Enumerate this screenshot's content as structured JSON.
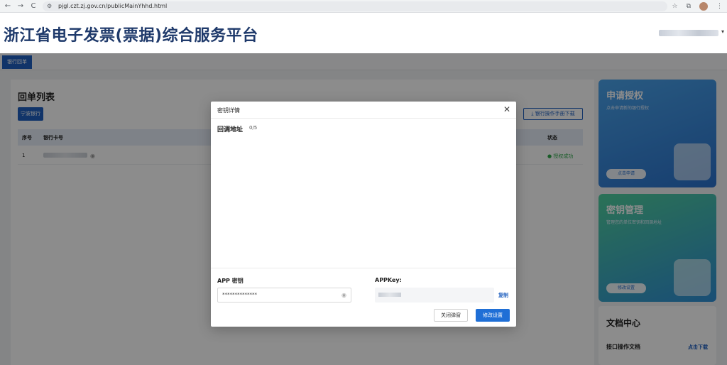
{
  "browser": {
    "url": "pjgl.czt.zj.gov.cn/publicMainYhhd.html",
    "back": "←",
    "forward": "→",
    "reload": "C",
    "menu": "⋮"
  },
  "header": {
    "title": "浙江省电子发票(票据)综合服务平台",
    "user_caret": "▾"
  },
  "tabs": {
    "active": "银行回单"
  },
  "list": {
    "title": "回单列表",
    "bank_button": "宁波银行",
    "manual_download": "⤓ 银行操作手册下载",
    "columns": {
      "index": "序号",
      "card": "银行卡号",
      "status": "状态"
    },
    "rows": [
      {
        "index": "1",
        "status": "● 授权成功"
      }
    ]
  },
  "side": {
    "apply": {
      "title": "申请授权",
      "subtitle": "点击申请新的银行授权",
      "button": "点击申请"
    },
    "key": {
      "title": "密钥管理",
      "subtitle": "管理您的单位密钥和回调地址",
      "button": "修改设置"
    },
    "docs": {
      "title": "文档中心",
      "item": "接口操作文档",
      "download": "点击下载"
    }
  },
  "modal": {
    "title": "密钥详情",
    "close": "✕",
    "callback_label": "回调地址",
    "callback_count": "0/5",
    "app_secret_label": "APP 密钥",
    "app_secret_value": "**************",
    "appkey_label": "APPKey:",
    "copy": "复制",
    "close_button": "关闭弹窗",
    "edit_button": "修改设置"
  }
}
